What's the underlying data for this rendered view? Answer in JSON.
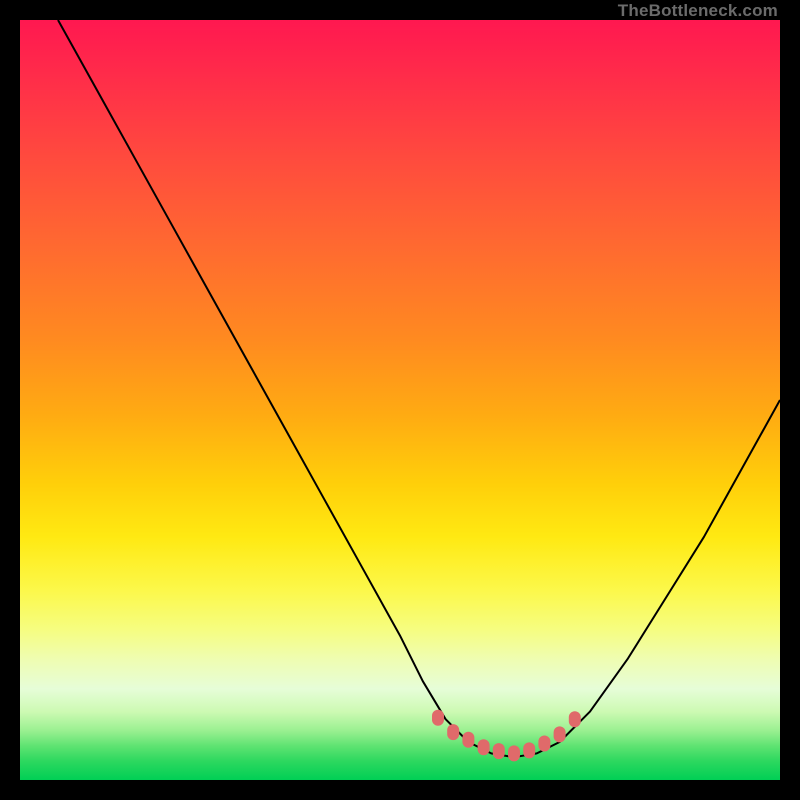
{
  "watermark": "TheBottleneck.com",
  "chart_data": {
    "type": "line",
    "title": "",
    "xlabel": "",
    "ylabel": "",
    "xlim": [
      0,
      100
    ],
    "ylim": [
      0,
      100
    ],
    "grid": false,
    "legend": false,
    "series": [
      {
        "name": "bottleneck-curve",
        "x": [
          5,
          10,
          15,
          20,
          25,
          30,
          35,
          40,
          45,
          50,
          53,
          56,
          59,
          62,
          65,
          68,
          71,
          75,
          80,
          85,
          90,
          95,
          100
        ],
        "y": [
          100,
          91,
          82,
          73,
          64,
          55,
          46,
          37,
          28,
          19,
          13,
          8,
          5,
          3.5,
          3,
          3.5,
          5,
          9,
          16,
          24,
          32,
          41,
          50
        ]
      }
    ],
    "optimal_zone": {
      "name": "optimal-markers",
      "x": [
        55,
        57,
        59,
        61,
        63,
        65,
        67,
        69,
        71,
        73
      ],
      "y": [
        8.2,
        6.3,
        5.3,
        4.3,
        3.8,
        3.5,
        3.9,
        4.8,
        6.0,
        8.0
      ]
    },
    "gradient_stops": [
      {
        "pos": 0.0,
        "color": "#ff1850"
      },
      {
        "pos": 0.3,
        "color": "#ff6a30"
      },
      {
        "pos": 0.6,
        "color": "#ffcf0a"
      },
      {
        "pos": 0.8,
        "color": "#f6fd7e"
      },
      {
        "pos": 0.93,
        "color": "#9af091"
      },
      {
        "pos": 1.0,
        "color": "#00cf55"
      }
    ]
  }
}
